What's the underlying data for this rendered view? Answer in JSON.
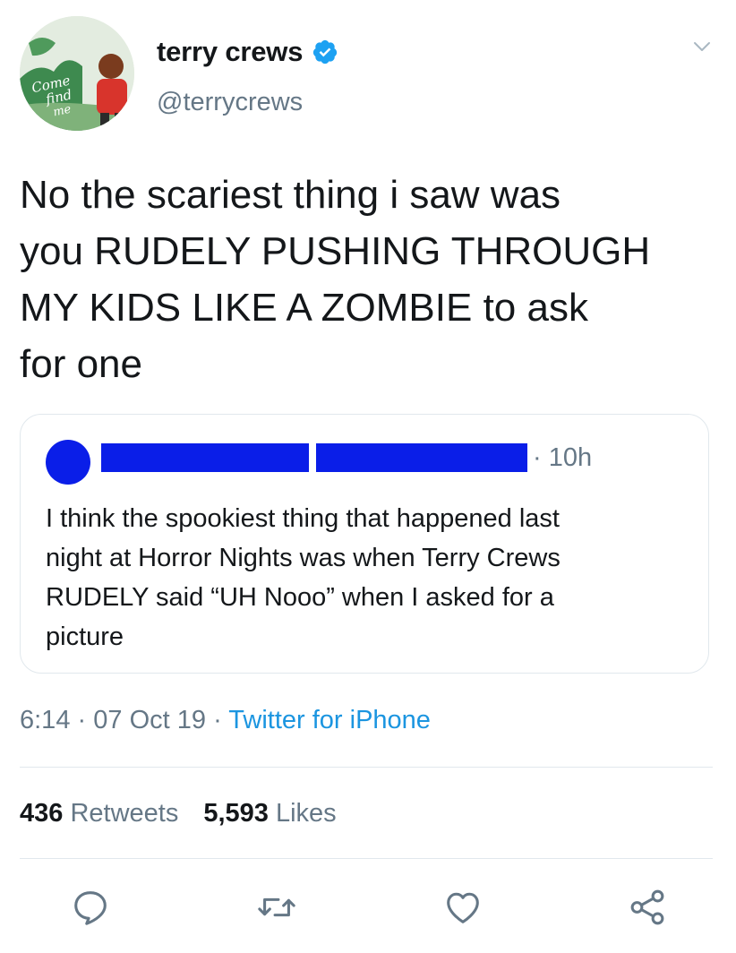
{
  "tweet": {
    "author_name": "terry crews",
    "author_handle": "@terrycrews",
    "text": "No the scariest thing i saw was\nyou RUDELY PUSHING THROUGH\nMY KIDS LIKE A ZOMBIE to ask\nfor one",
    "time": "6:14",
    "date": "07 Oct 19",
    "separator": "·",
    "source": "Twitter for iPhone"
  },
  "quoted_tweet": {
    "time": "· 10h",
    "text": "I think the spookiest thing that happened last\nnight at Horror Nights was when Terry Crews\nRUDELY said “UH Nooo” when I asked for a\npicture",
    "redaction_color": "#0a1ee8"
  },
  "stats": {
    "retweets_count": "436",
    "retweets_label": "Retweets",
    "likes_count": "5,593",
    "likes_label": "Likes"
  },
  "avatar": {
    "lettering": "Come find me"
  },
  "colors": {
    "text": "#14171a",
    "secondary": "#657786",
    "link": "#1b95e0",
    "border": "#e1e8ed"
  },
  "icons": [
    "verified-badge-icon",
    "chevron-down-icon",
    "reply-icon",
    "retweet-icon",
    "like-icon",
    "share-icon"
  ]
}
